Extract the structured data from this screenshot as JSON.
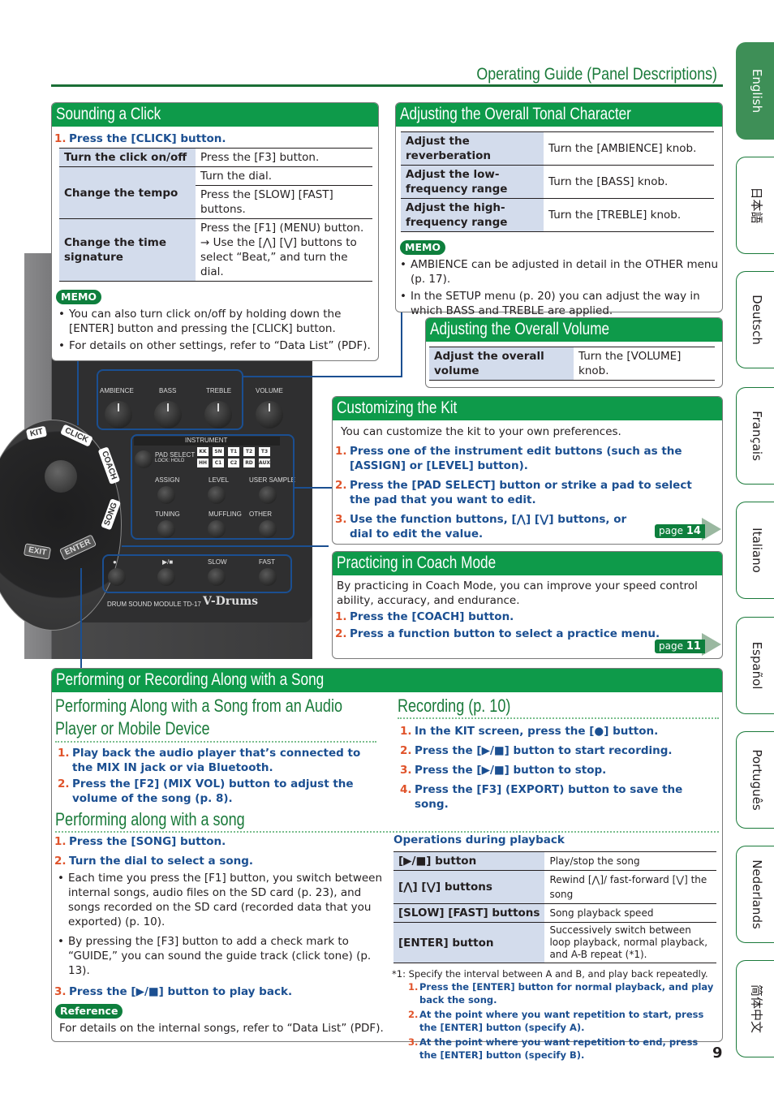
{
  "header": {
    "title": "Operating Guide (Panel Descriptions)"
  },
  "page_number": "9",
  "language_tabs": [
    {
      "label": "English",
      "active": true
    },
    {
      "label": "日本語",
      "active": false
    },
    {
      "label": "Deutsch",
      "active": false
    },
    {
      "label": "Français",
      "active": false
    },
    {
      "label": "Italiano",
      "active": false
    },
    {
      "label": "Español",
      "active": false
    },
    {
      "label": "Português",
      "active": false
    },
    {
      "label": "Nederlands",
      "active": false
    },
    {
      "label": "简体中文",
      "active": false
    }
  ],
  "click": {
    "title": "Sounding a Click",
    "step1": "Press the [CLICK] button.",
    "table": [
      {
        "k": "Turn the click on/off",
        "v": [
          "Press the [F3] button."
        ]
      },
      {
        "k": "Change the tempo",
        "v": [
          "Turn the dial.",
          "Press the [SLOW] [FAST] buttons."
        ]
      },
      {
        "k": "Change the time signature",
        "v": [
          "Press the [F1] (MENU) button. → Use the [⋀] [⋁] buttons to select “Beat,” and turn the dial."
        ]
      }
    ],
    "memo_label": "MEMO",
    "memo": [
      "You can also turn click on/off by holding down the [ENTER] button and pressing the [CLICK] button.",
      "For details on other settings, refer to “Data List” (PDF)."
    ]
  },
  "tonal": {
    "title": "Adjusting the Overall Tonal Character",
    "table": [
      {
        "k": "Adjust the reverberation",
        "v": "Turn the [AMBIENCE] knob."
      },
      {
        "k": "Adjust the low-frequency range",
        "v": "Turn the [BASS] knob."
      },
      {
        "k": "Adjust the high-frequency range",
        "v": "Turn the [TREBLE] knob."
      }
    ],
    "memo_label": "MEMO",
    "memo": [
      "AMBIENCE can be adjusted in detail in the OTHER menu (p. 17).",
      "In the SETUP menu (p. 20) you can adjust the way in which BASS and TREBLE are applied."
    ]
  },
  "volume": {
    "title": "Adjusting the Overall Volume",
    "k": "Adjust the overall volume",
    "v": "Turn the [VOLUME] knob."
  },
  "kit": {
    "title": "Customizing the Kit",
    "intro": "You can customize the kit to your own preferences.",
    "steps": [
      "Press one of the instrument edit buttons (such as the [ASSIGN] or [LEVEL] button).",
      "Press the [PAD SELECT] button or strike a pad to select the pad that you want to edit.",
      "Use the function buttons, [⋀] [⋁] buttons, or dial to edit the value."
    ],
    "page_label": "page",
    "page_num": "14"
  },
  "coach": {
    "title": "Practicing in Coach Mode",
    "intro": "By practicing in Coach Mode, you can improve your speed control ability, accuracy, and endurance.",
    "steps": [
      "Press the [COACH] button.",
      "Press a function button to select a practice menu."
    ],
    "page_label": "page",
    "page_num": "11"
  },
  "panel": {
    "knobs": [
      "AMBIENCE",
      "BASS",
      "TREBLE",
      "VOLUME"
    ],
    "instrument": "INSTRUMENT",
    "pad_select": "PAD SELECT",
    "lock_hold": "LOCK: HOLD",
    "pads_row1": [
      "KK",
      "SN",
      "T1",
      "T2",
      "T3"
    ],
    "pads_row2": [
      "HH",
      "C1",
      "C2",
      "RD",
      "AUX"
    ],
    "edit_row1": [
      "ASSIGN",
      "LEVEL",
      "USER SAMPLE"
    ],
    "edit_row2": [
      "TUNING",
      "MUFFLING",
      "OTHER"
    ],
    "transport": [
      "●",
      "▶/■",
      "SLOW",
      "FAST"
    ],
    "model": "DRUM SOUND MODULE  TD-17",
    "brand": "V-Drums",
    "ring": [
      "KIT",
      "CLICK",
      "COACH",
      "SONG",
      "ENTER",
      "EXIT"
    ]
  },
  "song": {
    "title": "Performing or Recording Along with a Song",
    "audio": {
      "title": "Performing Along with a Song from an Audio Player or Mobile Device",
      "steps": [
        "Play back the audio player that’s connected to the MIX IN jack or via Bluetooth.",
        "Press the [F2] (MIX VOL) button to adjust the volume of the song (p. 8)."
      ]
    },
    "recording": {
      "title": "Recording (p. 10)",
      "steps": [
        "In the KIT screen, press the [●] button.",
        "Press the [▶/■] button to start recording.",
        "Press the [▶/■] button to stop.",
        "Press the [F3] (EXPORT) button to save the song."
      ]
    },
    "along": {
      "title": "Performing along with a song",
      "step1": "Press the [SONG] button.",
      "step2": "Turn the dial to select a song.",
      "bullets": [
        "Each time you press the [F1] button, you switch between internal songs, audio files on the SD card (p. 23), and songs recorded on the SD card (recorded data that you exported) (p. 10).",
        "By pressing the [F3] button to add a check mark to “GUIDE,” you can sound the guide track (click tone) (p. 13)."
      ],
      "step3": "Press the [▶/■] button to play back.",
      "ref_label": "Reference",
      "ref_text": "For details on the internal songs, refer to “Data List” (PDF)."
    },
    "ops": {
      "title": "Operations during playback",
      "table": [
        {
          "k": "[▶/■] button",
          "v": "Play/stop the song"
        },
        {
          "k": "[⋀] [⋁] buttons",
          "v": "Rewind [⋀]/ fast-forward [⋁] the song"
        },
        {
          "k": "[SLOW] [FAST] buttons",
          "v": "Song playback speed"
        },
        {
          "k": "[ENTER] button",
          "v": "Successively switch between loop playback, normal playback, and A-B repeat (*1)."
        }
      ],
      "note": "*1: Specify the interval between A and B, and play back repeatedly.",
      "note_steps": [
        "Press the [ENTER] button for normal playback, and play back the song.",
        "At the point where you want repetition to start, press the [ENTER] button (specify A).",
        "At the point where you want repetition to end, press the [ENTER] button (specify B)."
      ]
    }
  }
}
